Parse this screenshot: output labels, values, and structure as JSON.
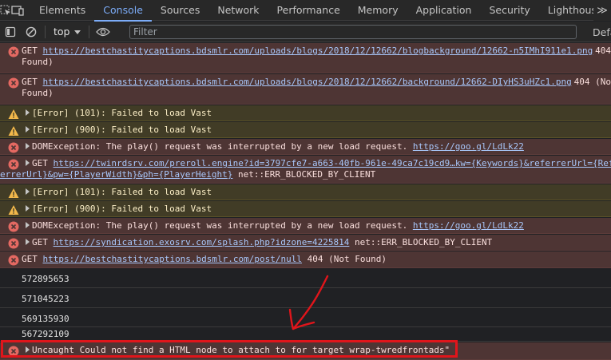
{
  "tabs": {
    "items": [
      "Elements",
      "Console",
      "Sources",
      "Network",
      "Performance",
      "Memory",
      "Application",
      "Security",
      "Lighthouse"
    ],
    "active": "Console",
    "more": "≫"
  },
  "toolbar": {
    "context": "top",
    "filter_placeholder": "Filter",
    "levels": "Defa"
  },
  "messages": [
    {
      "type": "error",
      "line1_pre": "GET ",
      "line1_link": "https://bestchastitycaptions.bdsmlr.com/uploads/blogs/2018/12/12662/blogbackground/12662-n5IMhI911e1.png",
      "line1_post": " 404",
      "line2": "Found)"
    },
    {
      "type": "error",
      "line1_pre": "GET ",
      "line1_link": "https://bestchastitycaptions.bdsmlr.com/uploads/blogs/2018/12/12662/background/12662-DIyHS3uHZc1.png",
      "line1_post": " 404 (No",
      "line2": "Found)"
    },
    {
      "type": "warning",
      "text": "[Error] (101): Failed to load Vast"
    },
    {
      "type": "warning",
      "text": "[Error] (900): Failed to load Vast"
    },
    {
      "type": "error",
      "text": "DOMException: The play() request was interrupted by a new load request. ",
      "link": "https://goo.gl/LdLk22"
    },
    {
      "type": "error",
      "line1_pre": "GET ",
      "line1_link": "https://twinrdsrv.com/preroll.engine?id=3797cfe7-a663-40fb-961e-49ca7c19cd9…kw={Keywords}&referrerUrl={Ref",
      "line2_link": "errerUrl}&pw={PlayerWidth}&ph={PlayerHeight}",
      "line2_post": " net::ERR_BLOCKED_BY_CLIENT"
    },
    {
      "type": "warning",
      "text": "[Error] (101): Failed to load Vast"
    },
    {
      "type": "warning",
      "text": "[Error] (900): Failed to load Vast"
    },
    {
      "type": "error",
      "text": "DOMException: The play() request was interrupted by a new load request. ",
      "link": "https://goo.gl/LdLk22"
    },
    {
      "type": "error",
      "pre": "GET ",
      "link": "https://syndication.exosrv.com/splash.php?idzone=4225814",
      "post": " net::ERR_BLOCKED_BY_CLIENT"
    },
    {
      "type": "error",
      "pre": "GET ",
      "link": "https://bestchastitycaptions.bdsmlr.com/post/null",
      "post": " 404 (Not Found)"
    },
    {
      "type": "log",
      "text": "572895653"
    },
    {
      "type": "log",
      "text": "571045223"
    },
    {
      "type": "log",
      "text": "569135930"
    },
    {
      "type": "log",
      "text": "567292109"
    },
    {
      "type": "error",
      "text": "Uncaught Could not find a HTML node to attach to for target wrap-twredfrontads\""
    }
  ],
  "colors": {
    "accent": "#7cacf8",
    "error_bg": "#4e3534",
    "warning_bg": "#413c26",
    "link": "#a8c7fa",
    "highlight": "#e0151b"
  }
}
